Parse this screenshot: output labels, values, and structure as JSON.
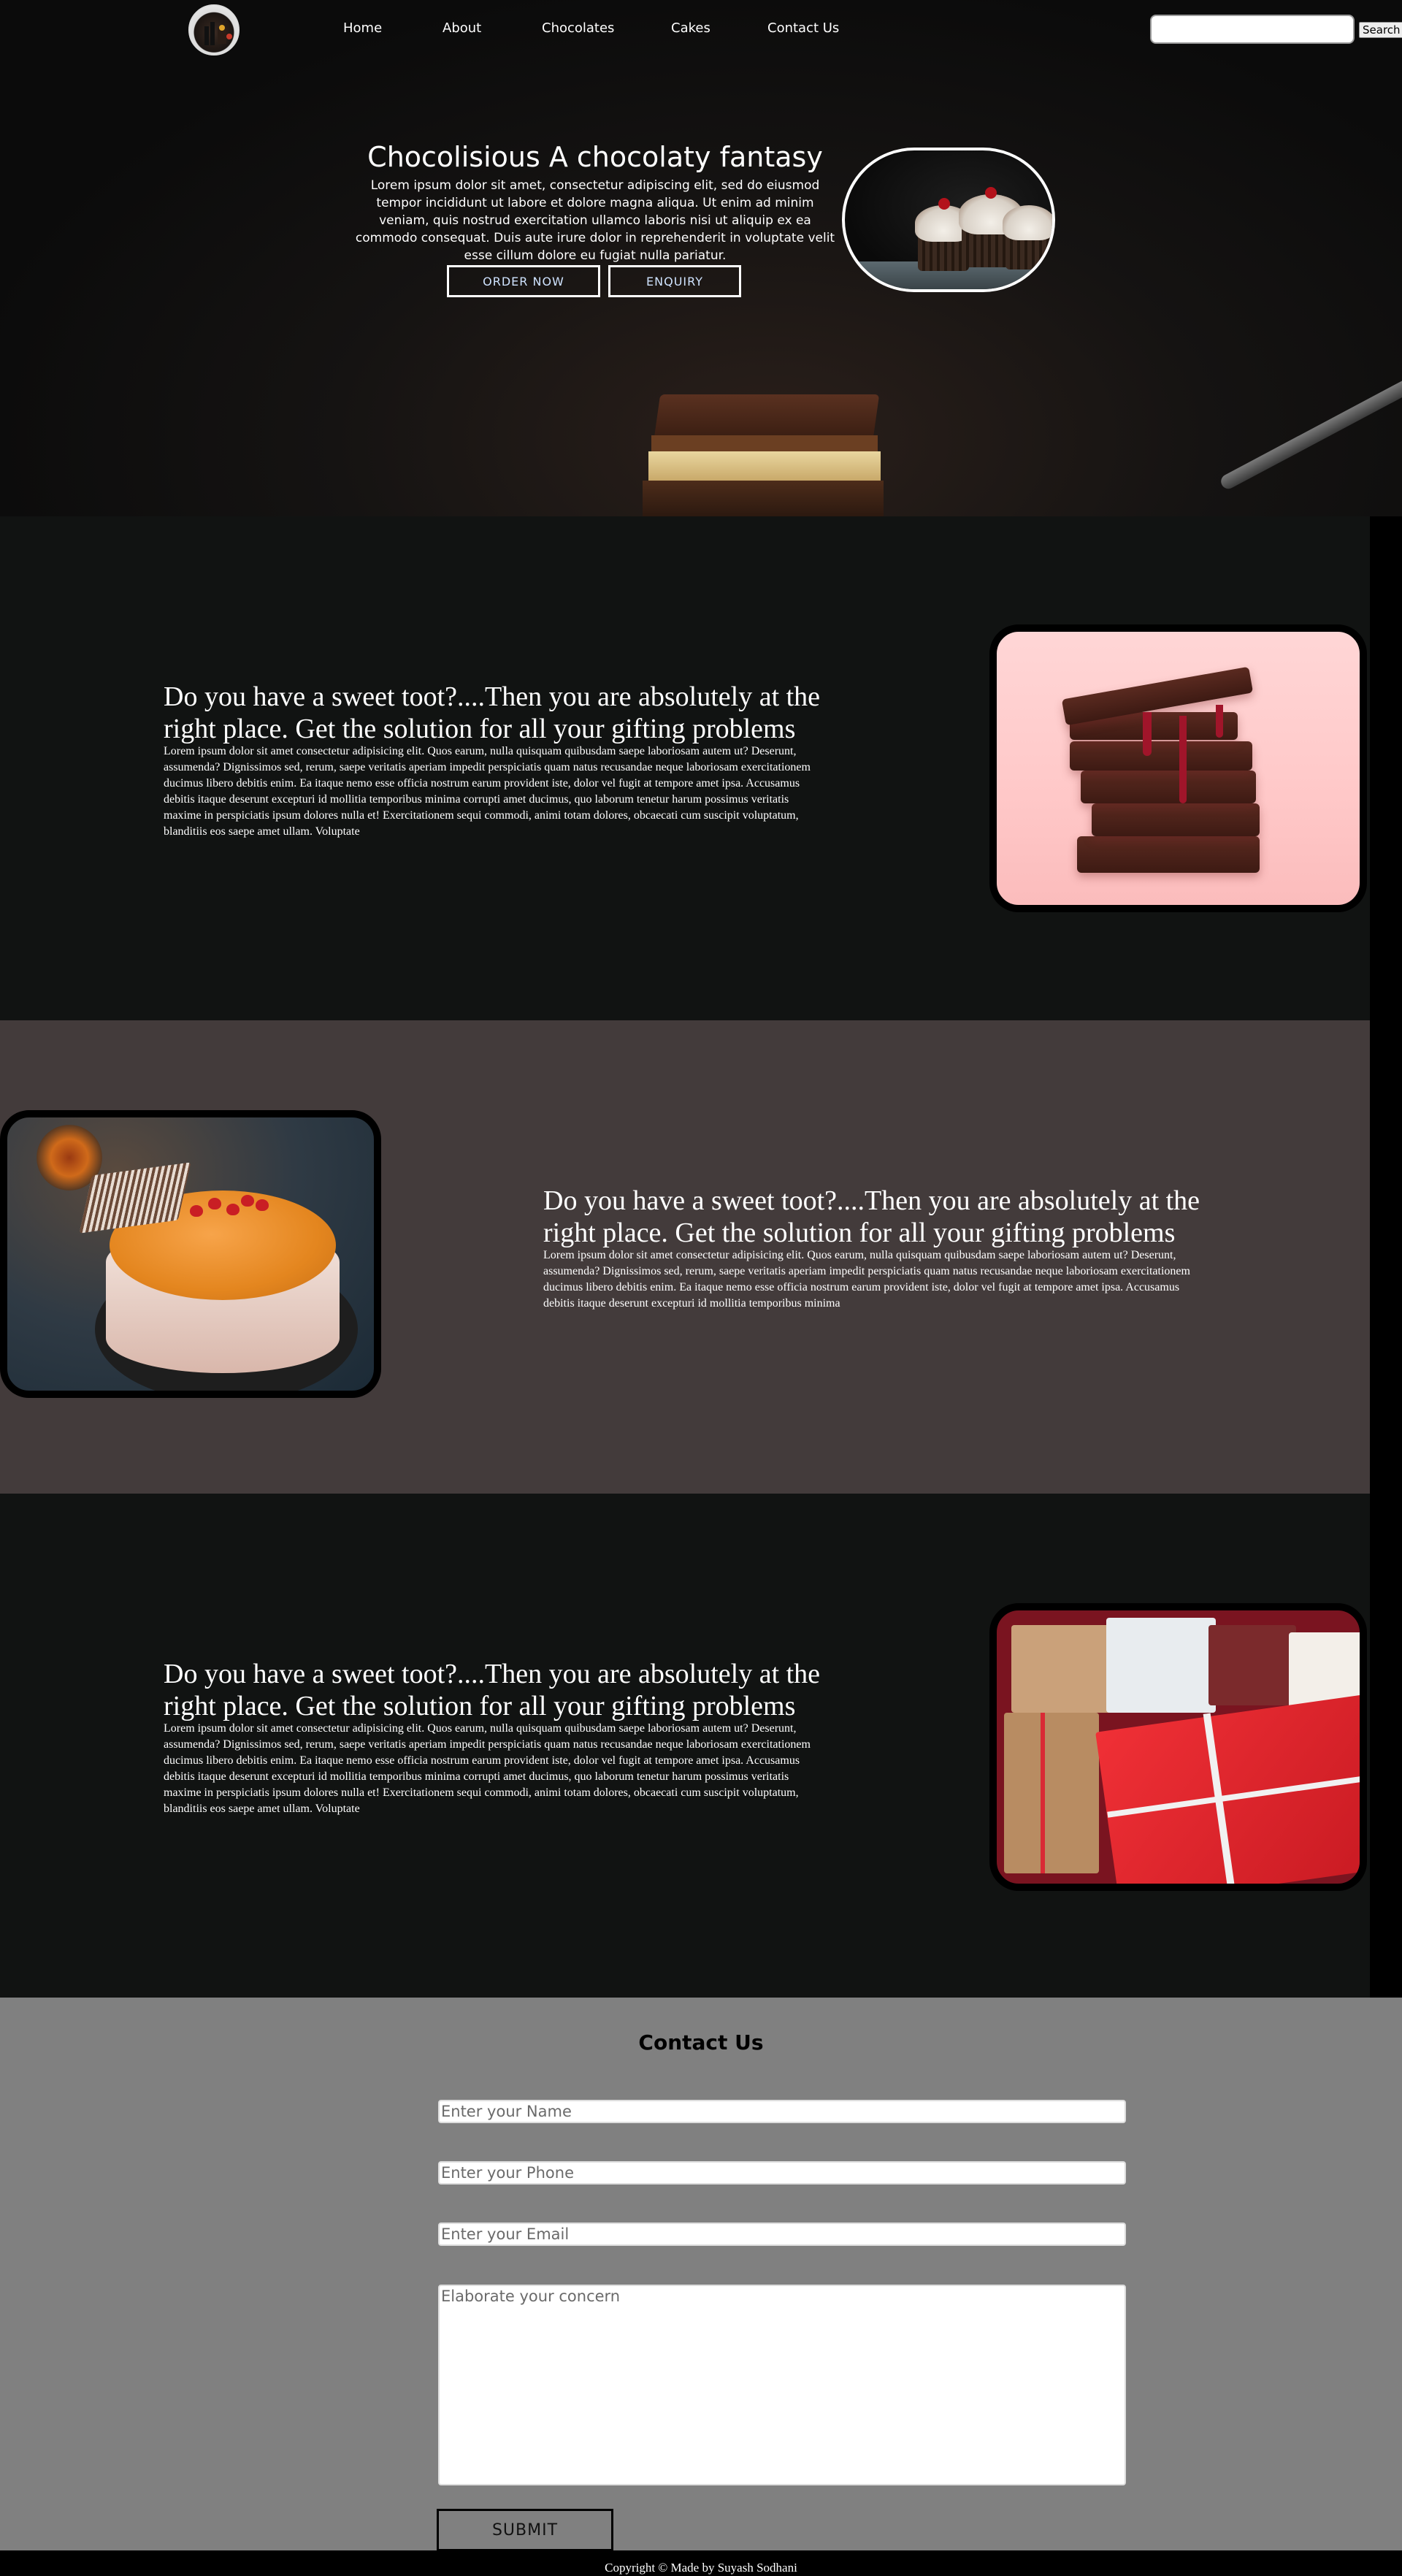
{
  "nav": {
    "links": [
      "Home",
      "About",
      "Chocolates",
      "Cakes",
      "Contact Us"
    ],
    "search_placeholder": "",
    "search_button": "Search",
    "logo_icon": "cupcake-logo-icon"
  },
  "hero": {
    "title": "Chocolisious A chocolaty fantasy",
    "text": "Lorem ipsum dolor sit amet, consectetur adipiscing elit, sed do eiusmod tempor incididunt ut labore et dolore magna aliqua. Ut enim ad minim veniam, quis nostrud exercitation ullamco laboris nisi ut aliquip ex ea commodo consequat. Duis aute irure dolor in reprehenderit in voluptate velit esse cillum dolore eu fugiat nulla pariatur.",
    "order_button": "ORDER NOW",
    "enquiry_button": "ENQUIRY"
  },
  "features": [
    {
      "heading": "Do you have a sweet toot?....Then you are absolutely at the right place. Get the solution for all your gifting problems",
      "text": "Lorem ipsum dolor sit amet consectetur adipisicing elit. Quos earum, nulla quisquam quibusdam saepe laboriosam autem ut? Deserunt, assumenda? Dignissimos sed, rerum, saepe veritatis aperiam impedit perspiciatis quam natus recusandae neque laboriosam exercitationem ducimus libero debitis enim. Ea itaque nemo esse officia nostrum earum provident iste, dolor vel fugit at tempore amet ipsa. Accusamus debitis itaque deserunt excepturi id mollitia temporibus minima corrupti amet ducimus, quo laborum tenetur harum possimus veritatis maxime in perspiciatis ipsum dolores nulla et! Exercitationem sequi commodi, animi totam dolores, obcaecati cum suscipit voluptatum, blanditiis eos saepe amet ullam. Voluptate"
    },
    {
      "heading": "Do you have a sweet toot?....Then you are absolutely at the right place. Get the solution for all your gifting problems",
      "text": "Lorem ipsum dolor sit amet consectetur adipisicing elit. Quos earum, nulla quisquam quibusdam saepe laboriosam autem ut? Deserunt, assumenda? Dignissimos sed, rerum, saepe veritatis aperiam impedit perspiciatis quam natus recusandae neque laboriosam exercitationem ducimus libero debitis enim. Ea itaque nemo esse officia nostrum earum provident iste, dolor vel fugit at tempore amet ipsa. Accusamus debitis itaque deserunt excepturi id mollitia temporibus minima"
    },
    {
      "heading": "Do you have a sweet toot?....Then you are absolutely at the right place. Get the solution for all your gifting problems",
      "text": "Lorem ipsum dolor sit amet consectetur adipisicing elit. Quos earum, nulla quisquam quibusdam saepe laboriosam autem ut? Deserunt, assumenda? Dignissimos sed, rerum, saepe veritatis aperiam impedit perspiciatis quam natus recusandae neque laboriosam exercitationem ducimus libero debitis enim. Ea itaque nemo esse officia nostrum earum provident iste, dolor vel fugit at tempore amet ipsa. Accusamus debitis itaque deserunt excepturi id mollitia temporibus minima corrupti amet ducimus, quo laborum tenetur harum possimus veritatis maxime in perspiciatis ipsum dolores nulla et! Exercitationem sequi commodi, animi totam dolores, obcaecati cum suscipit voluptatum, blanditiis eos saepe amet ullam. Voluptate"
    }
  ],
  "contact": {
    "title": "Contact Us",
    "name_placeholder": "Enter your Name",
    "phone_placeholder": "Enter your Phone",
    "email_placeholder": "Enter your Email",
    "concern_placeholder": "Elaborate your concern",
    "submit": "SUBMIT"
  },
  "footer": {
    "text": "Copyright © Made by Suyash Sodhani"
  },
  "colors": {
    "hero_bg": "#0b0b0b",
    "section_dark": "#111312",
    "section_brown": "#433b3b",
    "contact_bg": "#808080",
    "button_text": "#cfe3ff"
  }
}
